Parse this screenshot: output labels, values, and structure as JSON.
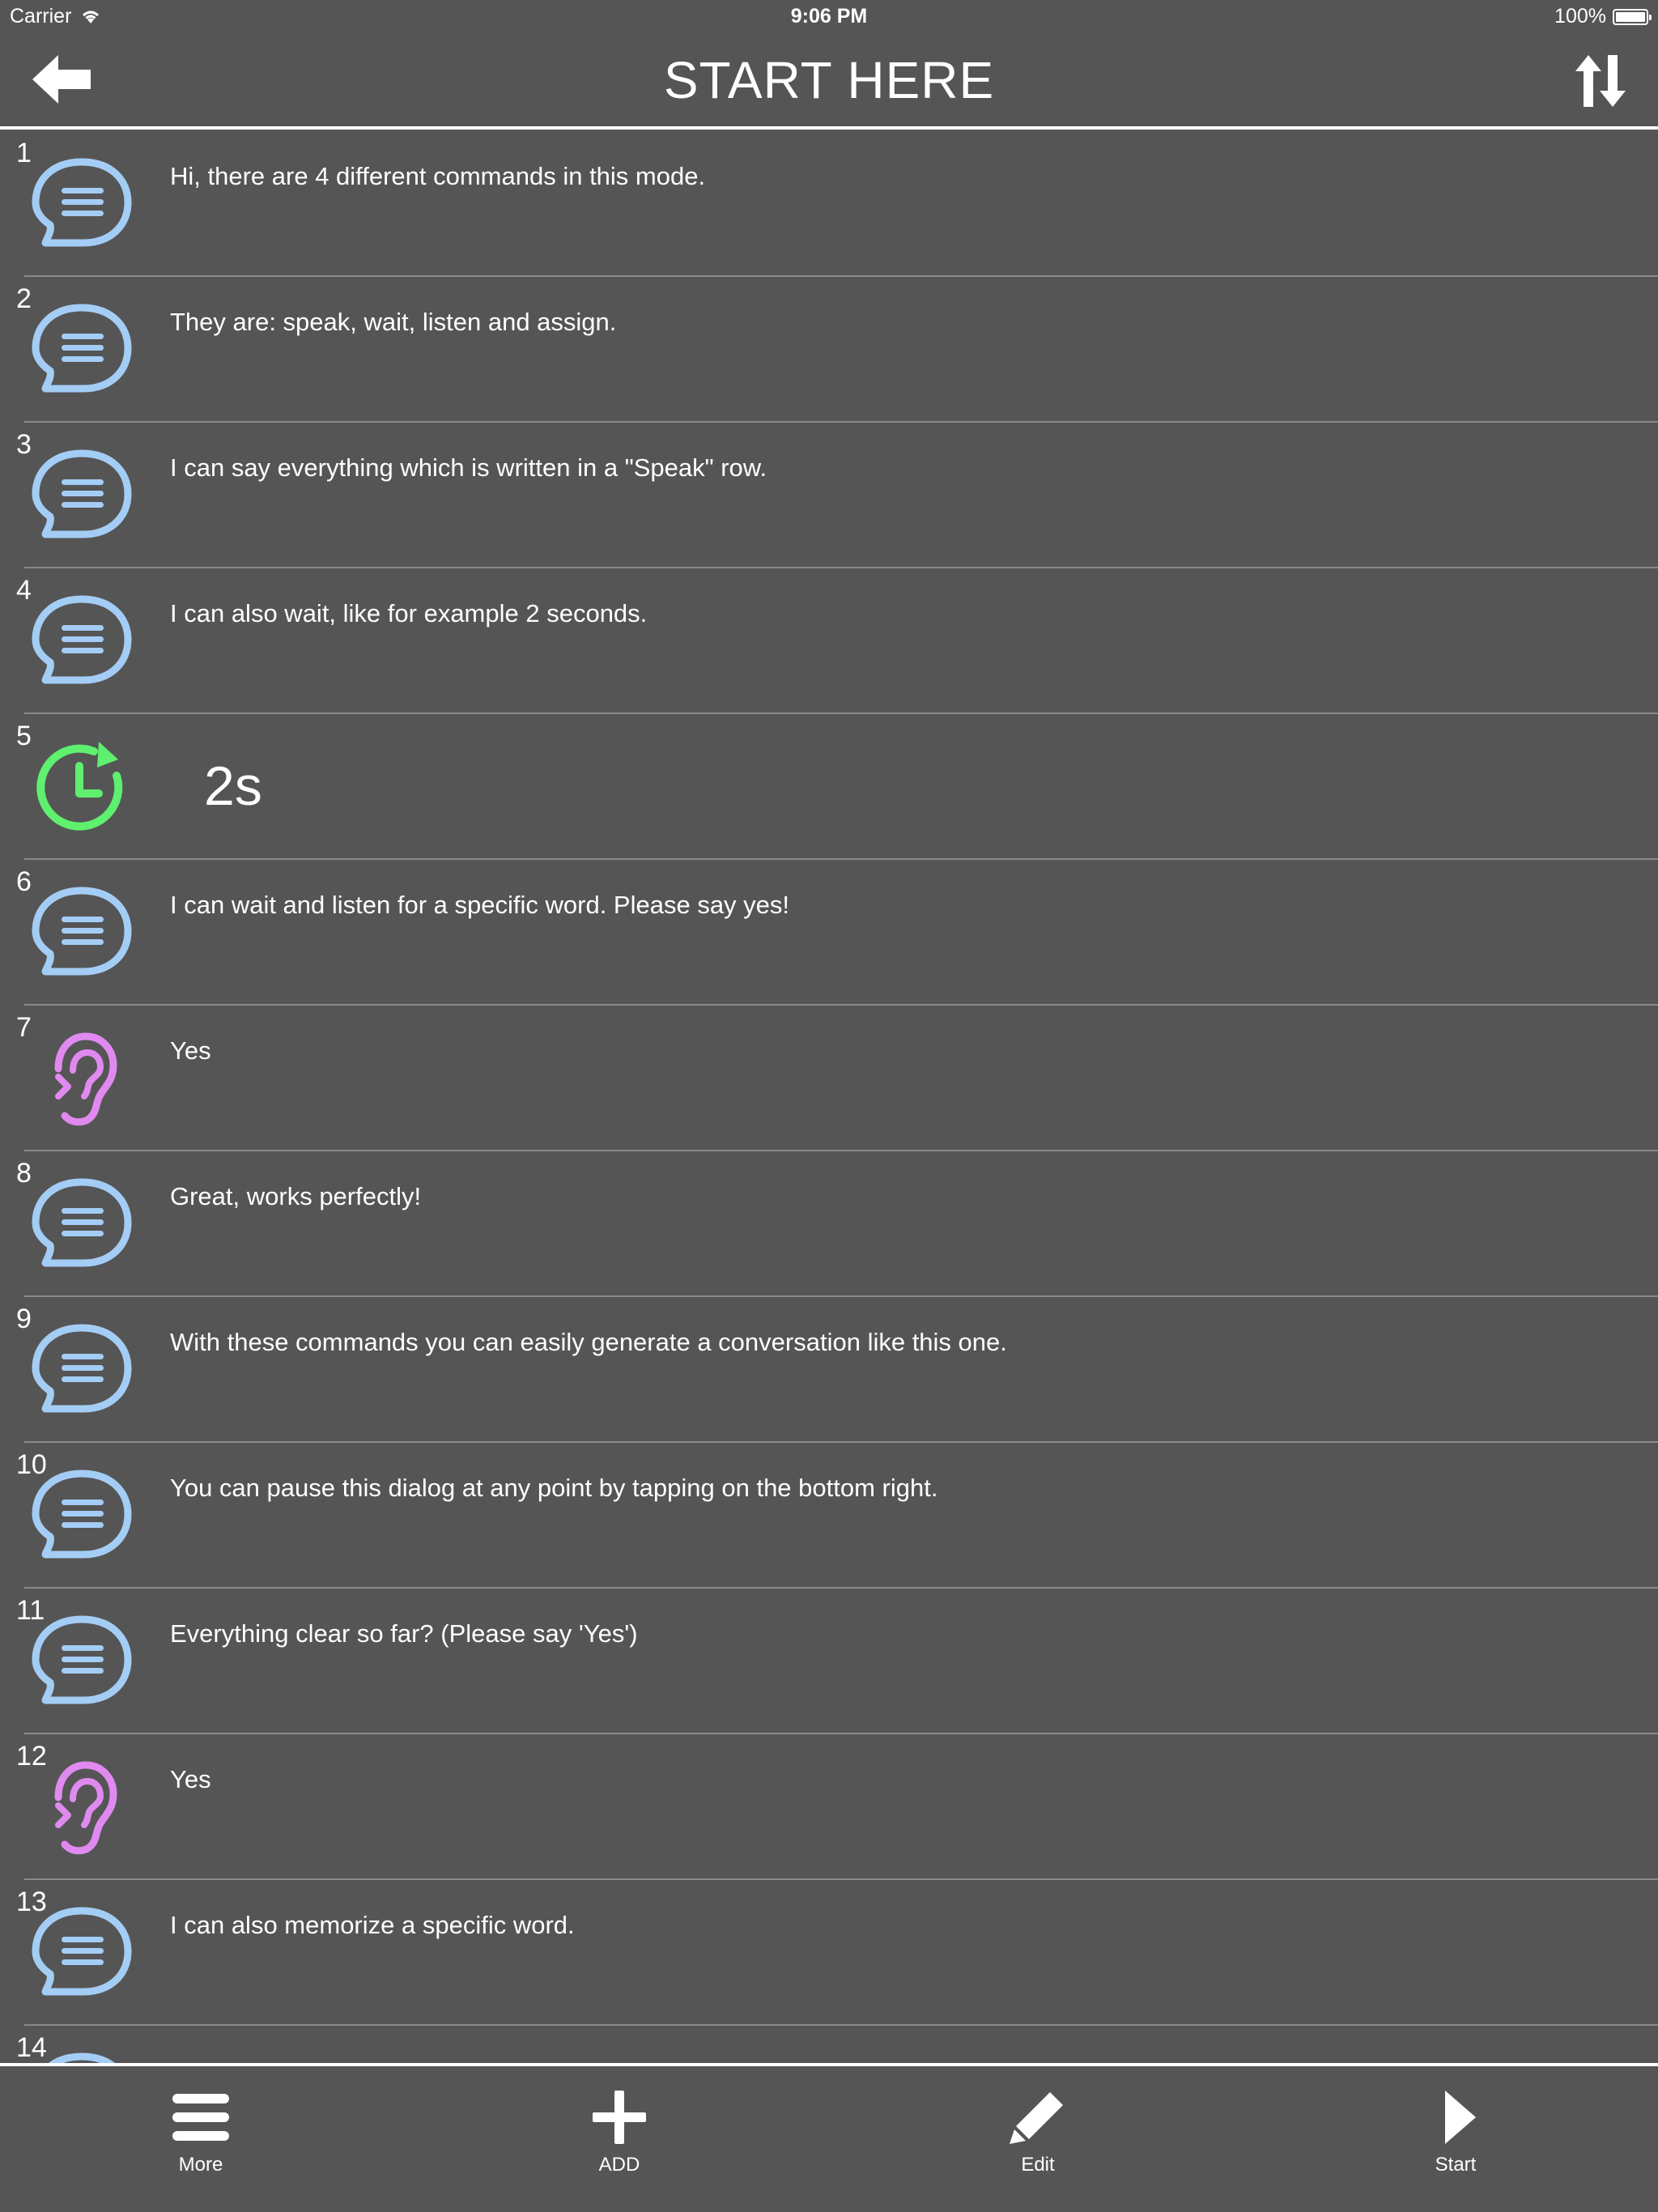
{
  "status_bar": {
    "carrier": "Carrier",
    "time": "9:06 PM",
    "battery": "100%"
  },
  "header": {
    "title": "START HERE",
    "back_icon": "arrow-left-icon",
    "sort_icon": "sort-arrows-icon"
  },
  "colors": {
    "background": "#555555",
    "speak_icon": "#a4cdf5",
    "wait_icon": "#5ef06e",
    "listen_icon": "#e08af0"
  },
  "rows": [
    {
      "number": "1",
      "type": "speak",
      "text": "Hi, there are 4 different commands in this mode."
    },
    {
      "number": "2",
      "type": "speak",
      "text": "They are: speak, wait, listen and assign."
    },
    {
      "number": "3",
      "type": "speak",
      "text": "I can say everything which is written in a \"Speak\" row."
    },
    {
      "number": "4",
      "type": "speak",
      "text": "I can also wait, like for example 2 seconds."
    },
    {
      "number": "5",
      "type": "wait",
      "text": "2s"
    },
    {
      "number": "6",
      "type": "speak",
      "text": "I can wait and listen for a specific word. Please say yes!"
    },
    {
      "number": "7",
      "type": "listen",
      "text": "Yes"
    },
    {
      "number": "8",
      "type": "speak",
      "text": "Great, works perfectly!"
    },
    {
      "number": "9",
      "type": "speak",
      "text": "With these commands you can easily generate a conversation like this one."
    },
    {
      "number": "10",
      "type": "speak",
      "text": "You can pause this dialog at any point by tapping on the bottom right."
    },
    {
      "number": "11",
      "type": "speak",
      "text": "Everything clear so far? (Please say 'Yes')"
    },
    {
      "number": "12",
      "type": "listen",
      "text": "Yes"
    },
    {
      "number": "13",
      "type": "speak",
      "text": "I can also memorize a specific word."
    },
    {
      "number": "14",
      "type": "speak",
      "text": ""
    }
  ],
  "tab_bar": {
    "more": "More",
    "add": "ADD",
    "edit": "Edit",
    "start": "Start"
  }
}
